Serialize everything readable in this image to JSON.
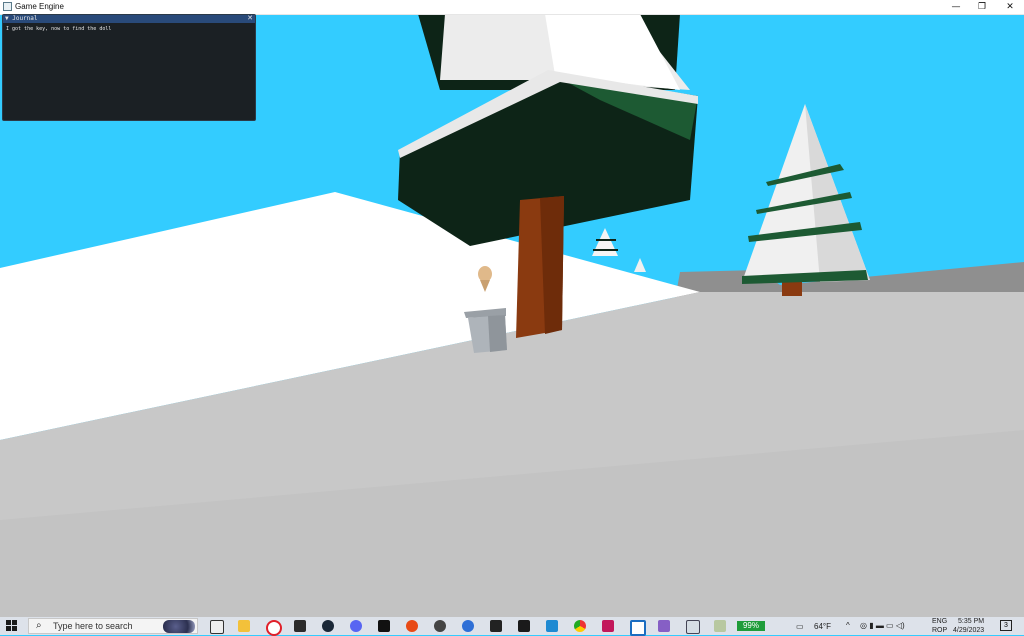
{
  "window": {
    "title": "Game Engine",
    "minimize": "—",
    "restore": "❐",
    "close": "✕"
  },
  "journal": {
    "title": "▼ Journal",
    "close": "✕",
    "text": "I got the key, now to find the doll"
  },
  "scene": {
    "sky_color": "#33ccff",
    "snow_color": "#ffffff",
    "ground_color": "#c9c9c9",
    "foliage_color": "#0d2417",
    "trunk_color": "#8a3a10"
  },
  "taskbar": {
    "search_placeholder": "Type here to search",
    "battery": "99%",
    "temperature": "64°F",
    "language_1": "ENG",
    "language_2": "ROP",
    "time": "5:35 PM",
    "date": "4/29/2023",
    "apps": [
      "task-view-icon",
      "file-explorer-icon",
      "opera-icon",
      "nvidia-icon",
      "steam-icon",
      "discord-icon",
      "pycharm-icon",
      "ea-icon",
      "obs-icon",
      "blender-icon",
      "epic-games-icon",
      "clion-icon",
      "vscode-icon",
      "chrome-icon",
      "rider-icon",
      "editor-icon",
      "visual-studio-icon",
      "app-icon",
      "paint-icon"
    ]
  }
}
